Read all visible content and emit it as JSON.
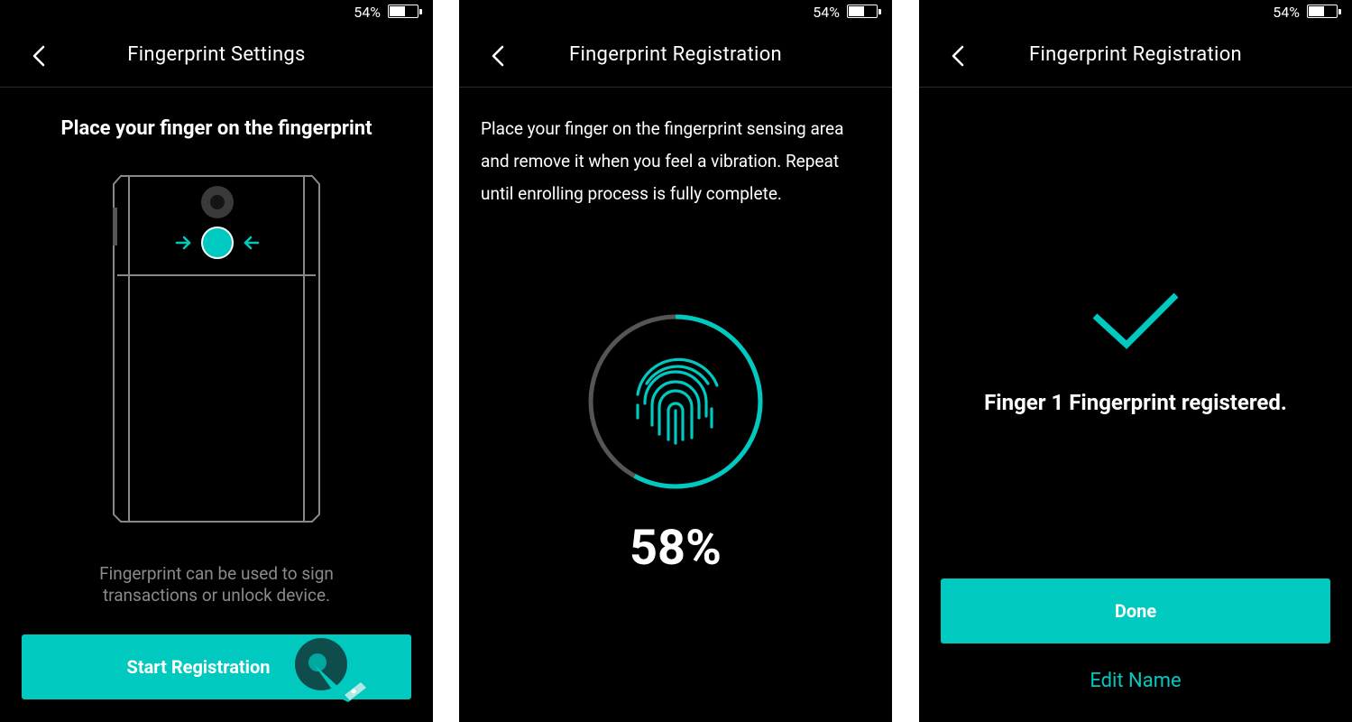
{
  "status": {
    "battery_pct": "54%"
  },
  "accent_color": "#00c9bf",
  "screens": [
    {
      "title": "Fingerprint Settings",
      "heading": "Place your finger on the fingerprint",
      "description": "Fingerprint can be used to sign transactions or unlock device.",
      "button_label": "Start Registration",
      "icons": [
        "back-arrow-icon",
        "phone-illustration",
        "tap-hand-icon"
      ]
    },
    {
      "title": "Fingerprint Registration",
      "instructions": "Place your finger on the fingerprint sensing area and remove it when you feel a vibration. Repeat until enrolling process is fully complete.",
      "progress_label": "58%",
      "progress": 0.58,
      "icons": [
        "back-arrow-icon",
        "fingerprint-icon"
      ]
    },
    {
      "title": "Fingerprint Registration",
      "message": "Finger 1 Fingerprint registered.",
      "done_label": "Done",
      "edit_label": "Edit Name",
      "icons": [
        "back-arrow-icon",
        "checkmark-icon"
      ]
    }
  ]
}
